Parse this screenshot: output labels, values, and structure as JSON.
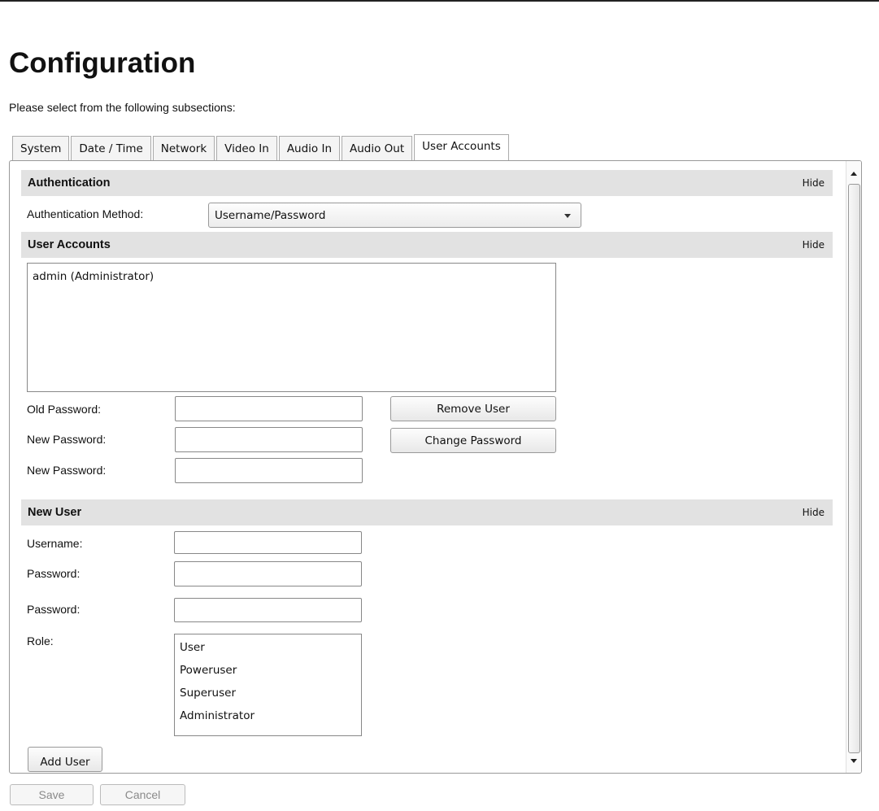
{
  "page": {
    "title": "Configuration",
    "subtitle": "Please select from the following subsections:"
  },
  "tabs": [
    {
      "label": "System"
    },
    {
      "label": "Date / Time"
    },
    {
      "label": "Network"
    },
    {
      "label": "Video In"
    },
    {
      "label": "Audio In"
    },
    {
      "label": "Audio Out"
    },
    {
      "label": "User Accounts",
      "active": true
    }
  ],
  "authentication": {
    "title": "Authentication",
    "hide_label": "Hide",
    "method_label": "Authentication Method:",
    "method_value": "Username/Password"
  },
  "user_accounts": {
    "title": "User Accounts",
    "hide_label": "Hide",
    "users": [
      "admin (Administrator)"
    ],
    "old_password_label": "Old Password:",
    "new_password_label": "New Password:",
    "new_password_confirm_label": "New Password:",
    "old_password_value": "",
    "new_password_value": "",
    "new_password_confirm_value": "",
    "remove_user_button": "Remove User",
    "change_password_button": "Change Password"
  },
  "new_user": {
    "title": "New User",
    "hide_label": "Hide",
    "username_label": "Username:",
    "password_label": "Password:",
    "password_confirm_label": "Password:",
    "role_label": "Role:",
    "username_value": "",
    "password_value": "",
    "password_confirm_value": "",
    "roles": [
      "User",
      "Poweruser",
      "Superuser",
      "Administrator"
    ],
    "add_user_button": "Add User"
  },
  "footer": {
    "save_button": "Save",
    "cancel_button": "Cancel"
  }
}
